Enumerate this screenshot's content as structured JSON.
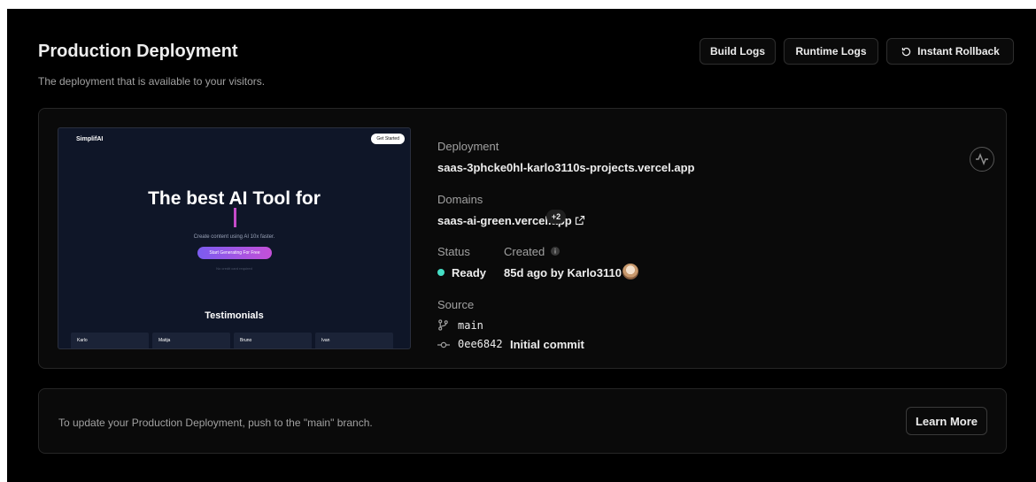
{
  "header": {
    "title": "Production Deployment",
    "subtitle": "The deployment that is available to your visitors.",
    "build_logs": "Build Logs",
    "runtime_logs": "Runtime Logs",
    "instant_rollback": "Instant Rollback"
  },
  "preview": {
    "logo": "SimplifAI",
    "get_started": "Get Started",
    "headline": "The best AI Tool for",
    "sub": "Create content using AI 10x faster.",
    "cta": "Start Generating For Free",
    "note": "No credit card required",
    "testimonials_title": "Testimonials",
    "testimonial_names": [
      "Karlo",
      "Matija",
      "Bruno",
      "Ivan"
    ],
    "accent_color": "#c44bc9"
  },
  "info": {
    "deployment_label": "Deployment",
    "deployment_value": "saas-3phcke0hl-karlo3110s-projects.vercel.app",
    "domains_label": "Domains",
    "domain_value": "saas-ai-green.vercel.app",
    "domain_extra": "+2",
    "status_label": "Status",
    "status_value": "Ready",
    "status_color": "#45dec5",
    "created_label": "Created",
    "created_value": "85d ago by Karlo3110",
    "source_label": "Source",
    "branch": "main",
    "commit_hash": "0ee6842",
    "commit_message": "Initial commit"
  },
  "footer": {
    "text": "To update your Production Deployment, push to the \"main\" branch.",
    "learn_more": "Learn More"
  },
  "icons": [
    "rollback-icon",
    "activity-icon",
    "external-link-icon",
    "info-icon",
    "git-branch-icon",
    "git-commit-icon"
  ]
}
